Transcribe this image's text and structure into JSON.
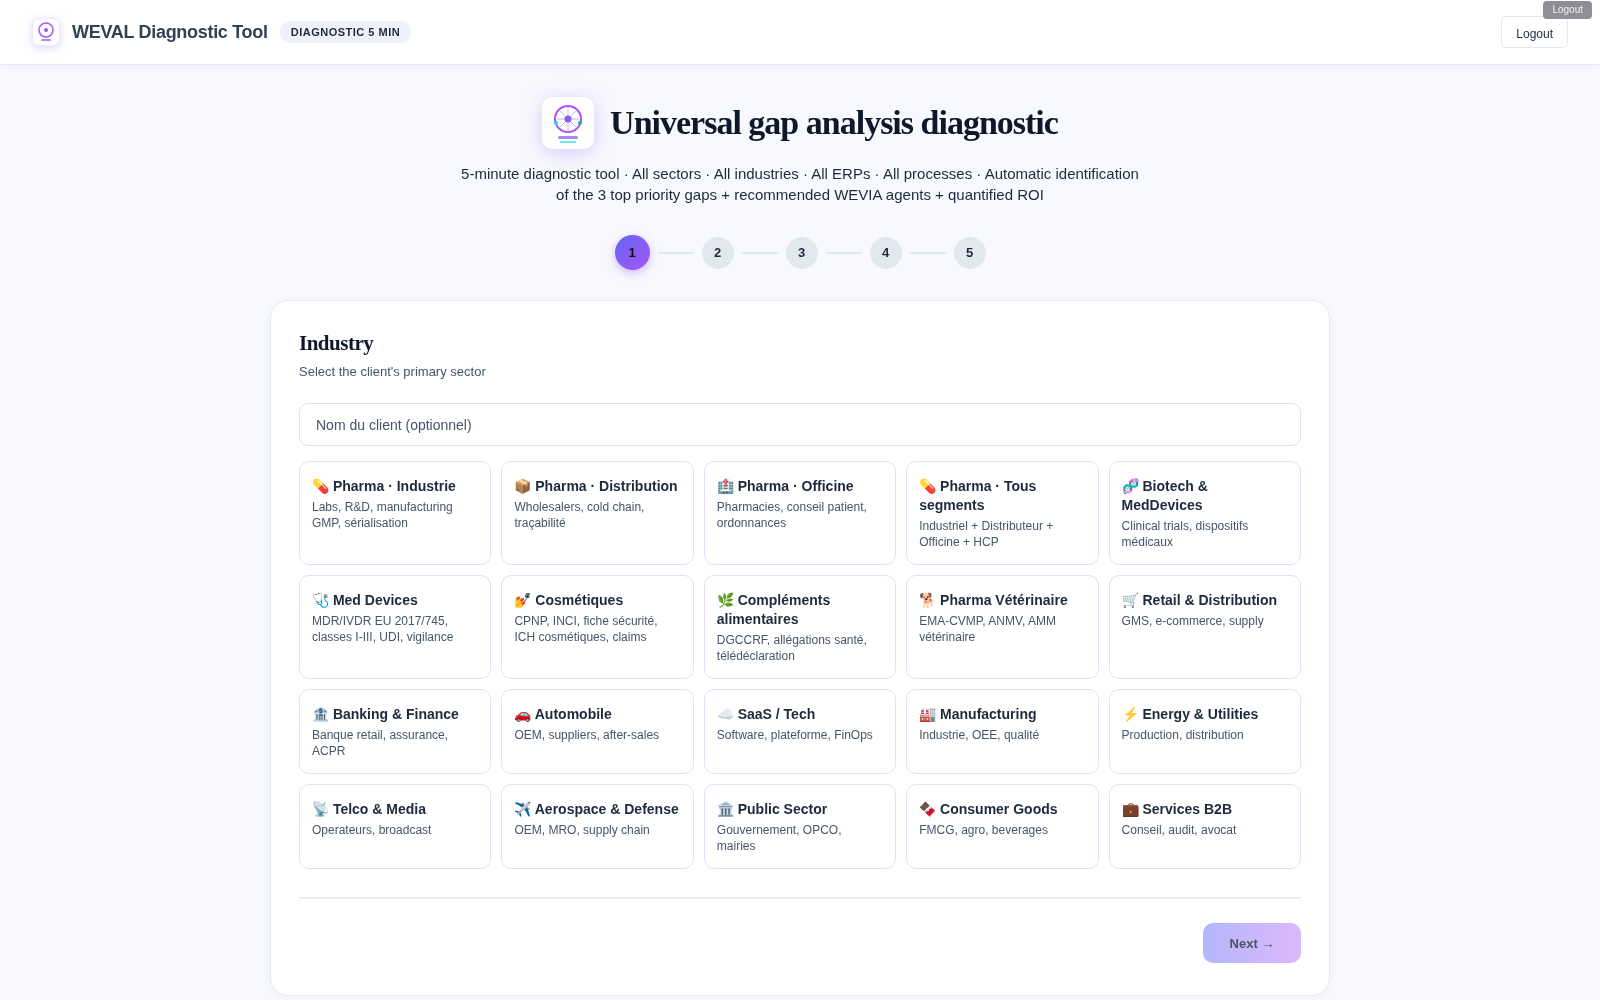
{
  "header": {
    "title": "WEVAL Diagnostic Tool",
    "badge": "DIAGNOSTIC 5 MIN",
    "logout_button": "Logout",
    "tooltip": "Logout"
  },
  "hero": {
    "title": "Universal gap analysis diagnostic",
    "subtitle": "5-minute diagnostic tool · All sectors · All industries · All ERPs · All processes · Automatic identification of the 3 top priority gaps + recommended WEVIA agents + quantified ROI"
  },
  "steps": [
    {
      "label": "1",
      "selected": true
    },
    {
      "label": "2",
      "selected": false
    },
    {
      "label": "3",
      "selected": false
    },
    {
      "label": "4",
      "selected": false
    },
    {
      "label": "5",
      "selected": false
    }
  ],
  "panel": {
    "title": "Industry",
    "subtitle": "Select the client's primary sector",
    "client_field": {
      "placeholder": "Nom du client (optionnel)"
    },
    "industries": [
      {
        "icon": "💊",
        "name": "Pharma · Industrie",
        "description": "Labs, R&D, manufacturing GMP, sérialisation",
        "selected": false
      },
      {
        "icon": "📦",
        "name": "Pharma · Distribution",
        "description": "Wholesalers, cold chain, traçabilité",
        "selected": false
      },
      {
        "icon": "🏥",
        "name": "Pharma · Officine",
        "description": "Pharmacies, conseil patient, ordonnances",
        "selected": false
      },
      {
        "icon": "💊",
        "name": "Pharma · Tous segments",
        "description": "Industriel + Distributeur + Officine + HCP",
        "selected": false
      },
      {
        "icon": "🧬",
        "name": "Biotech & MedDevices",
        "description": "Clinical trials, dispositifs médicaux",
        "selected": false
      },
      {
        "icon": "🩺",
        "name": "Med Devices",
        "description": "MDR/IVDR EU 2017/745, classes I-III, UDI, vigilance",
        "selected": false
      },
      {
        "icon": "💅",
        "name": "Cosmétiques",
        "description": "CPNP, INCI, fiche sécurité, ICH cosmétiques, claims",
        "selected": false
      },
      {
        "icon": "🌿",
        "name": "Compléments alimentaires",
        "description": "DGCCRF, allégations santé, télédéclaration",
        "selected": false
      },
      {
        "icon": "🐕",
        "name": "Pharma Vétérinaire",
        "description": "EMA-CVMP, ANMV, AMM vétérinaire",
        "selected": false
      },
      {
        "icon": "🛒",
        "name": "Retail & Distribution",
        "description": "GMS, e-commerce, supply",
        "selected": false
      },
      {
        "icon": "🏦",
        "name": "Banking & Finance",
        "description": "Banque retail, assurance, ACPR",
        "selected": false
      },
      {
        "icon": "🚗",
        "name": "Automobile",
        "description": "OEM, suppliers, after-sales",
        "selected": false
      },
      {
        "icon": "☁️",
        "name": "SaaS / Tech",
        "description": "Software, plateforme, FinOps",
        "selected": false
      },
      {
        "icon": "🏭",
        "name": "Manufacturing",
        "description": "Industrie, OEE, qualité",
        "selected": false
      },
      {
        "icon": "⚡",
        "name": "Energy & Utilities",
        "description": "Production, distribution",
        "selected": false
      },
      {
        "icon": "📡",
        "name": "Telco & Media",
        "description": "Operateurs, broadcast",
        "selected": false
      },
      {
        "icon": "✈️",
        "name": "Aerospace & Defense",
        "description": "OEM, MRO, supply chain",
        "selected": false
      },
      {
        "icon": "🏛️",
        "name": "Public Sector",
        "description": "Gouvernement, OPCO, mairies",
        "selected": false
      },
      {
        "icon": "🍫",
        "name": "Consumer Goods",
        "description": "FMCG, agro, beverages",
        "selected": false
      },
      {
        "icon": "💼",
        "name": "Services B2B",
        "description": "Conseil, audit, avocat",
        "selected": false
      }
    ],
    "next_button": {
      "label": "Next →",
      "disabled": true
    }
  }
}
